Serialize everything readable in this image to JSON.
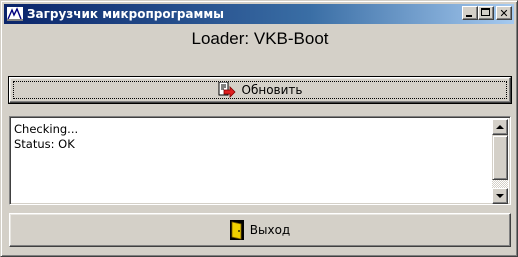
{
  "window": {
    "title": "Загрузчик микропрограммы",
    "icon": "firmware-loader-icon",
    "title_color_start": "#0a246a",
    "title_color_end": "#a6caf0"
  },
  "title_buttons": {
    "minimize": "minimize-icon",
    "maximize": "maximize-icon",
    "close_glyph": "✕"
  },
  "loader": {
    "label": "Loader: VKB-Boot"
  },
  "refresh_button": {
    "label": "Обновить",
    "icon": "refresh-document-arrow-icon"
  },
  "log": {
    "lines": [
      "Checking...",
      "Status: OK"
    ]
  },
  "exit_button": {
    "label": "Выход",
    "icon": "exit-door-icon"
  }
}
